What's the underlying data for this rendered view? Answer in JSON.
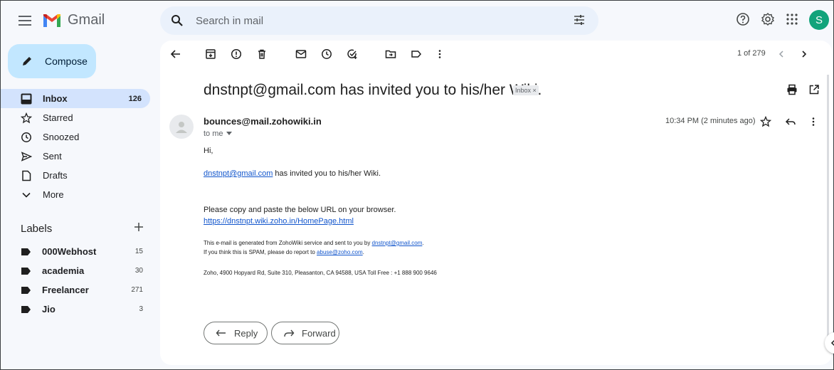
{
  "app": {
    "name": "Gmail"
  },
  "search": {
    "placeholder": "Search in mail"
  },
  "profile": {
    "initial": "S",
    "color": "#12a37b"
  },
  "compose": {
    "label": "Compose"
  },
  "nav": [
    {
      "label": "Inbox",
      "count": "126",
      "icon": "inbox-icon"
    },
    {
      "label": "Starred",
      "count": "",
      "icon": "star-icon"
    },
    {
      "label": "Snoozed",
      "count": "",
      "icon": "clock-icon"
    },
    {
      "label": "Sent",
      "count": "",
      "icon": "send-icon"
    },
    {
      "label": "Drafts",
      "count": "",
      "icon": "draft-icon"
    },
    {
      "label": "More",
      "count": "",
      "icon": "chevron-down-icon"
    }
  ],
  "labels": {
    "title": "Labels",
    "items": [
      {
        "label": "000Webhost",
        "count": "15"
      },
      {
        "label": "academia",
        "count": "30"
      },
      {
        "label": "Freelancer",
        "count": "271"
      },
      {
        "label": "Jio",
        "count": "3"
      }
    ]
  },
  "toolbar": {
    "pager": "1 of 279"
  },
  "email": {
    "subject": "dnstnpt@gmail.com has invited you to his/her Wiki.",
    "label_chip": "Inbox ×",
    "sender": "bounces@mail.zohowiki.in",
    "to": "to me",
    "time": "10:34 PM (2 minutes ago)",
    "greeting": "Hi,",
    "invite_link": "dnstnpt@gmail.com",
    "invite_text": " has invited you to his/her Wiki.",
    "copy_text": "Please copy and paste the below URL on your browser.",
    "url": "https://dnstnpt.wiki.zoho.in/HomePage.html",
    "footer1_pre": "This e-mail is generated from ZohoWiki service and sent to you by ",
    "footer1_link": "dnstnpt@gmail.com",
    "footer1_post": ".",
    "footer2_pre": "If you think this is SPAM, please do report to ",
    "footer2_link": "abuse@zoho.com",
    "footer2_post": ".",
    "address": "Zoho, 4900 Hopyard Rd, Suite 310, Pleasanton, CA 94588, USA Toll Free : +1 888 900 9646"
  },
  "actions": {
    "reply": "Reply",
    "forward": "Forward"
  }
}
